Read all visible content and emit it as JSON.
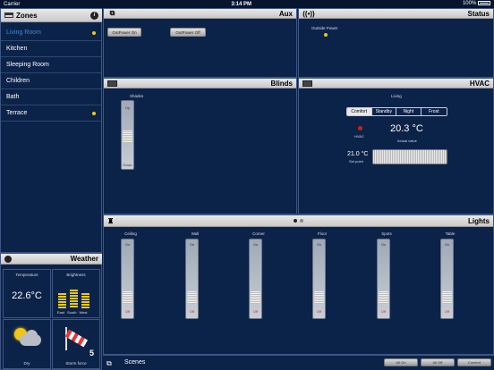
{
  "status_bar": {
    "carrier": "Carrier",
    "time": "3:14 PM",
    "battery": "100%"
  },
  "zones": {
    "title": "Zones",
    "items": [
      {
        "label": "Living Room",
        "active": true,
        "indicator": true
      },
      {
        "label": "Kitchen",
        "active": false,
        "indicator": false
      },
      {
        "label": "Sleeping Room",
        "active": false,
        "indicator": false
      },
      {
        "label": "Children",
        "active": false,
        "indicator": false
      },
      {
        "label": "Bath",
        "active": false,
        "indicator": false
      },
      {
        "label": "Terrace",
        "active": false,
        "indicator": true
      }
    ]
  },
  "aux": {
    "title": "Aux",
    "btn_on": "OutPower On",
    "btn_off": "OutPower Off"
  },
  "status": {
    "title": "Status",
    "item": "Outside Power",
    "indicator_color": "#e9c919"
  },
  "blinds": {
    "title": "Blinds",
    "name": "Shades",
    "up": "Up",
    "down": "Down"
  },
  "hvac": {
    "title": "HVAC",
    "room": "Living",
    "modes": [
      "Comfort",
      "Standby",
      "Night",
      "Frost"
    ],
    "selected_mode": "Comfort",
    "hvac_label": "HVAC",
    "actual_value": "20.3 °C",
    "actual_label": "Actual value",
    "set_value": "21.0 °C",
    "set_label": "Set point"
  },
  "lights": {
    "title": "Lights",
    "on_label": "On",
    "off_label": "Off",
    "channels": [
      "Ceiling",
      "Wall",
      "Corner",
      "Floor",
      "Spots",
      "Table"
    ]
  },
  "weather": {
    "title": "Weather",
    "temperature_label": "Temperature",
    "temperature": "22.6°C",
    "brightness_label": "Brightness",
    "brightness_cols": [
      "East",
      "South",
      "West"
    ],
    "condition": "Dry",
    "wind_label": "Storm force",
    "wind_value": "5"
  },
  "scenes": {
    "title": "Scenes",
    "buttons": [
      "All On",
      "All Off",
      "Comfort"
    ]
  }
}
